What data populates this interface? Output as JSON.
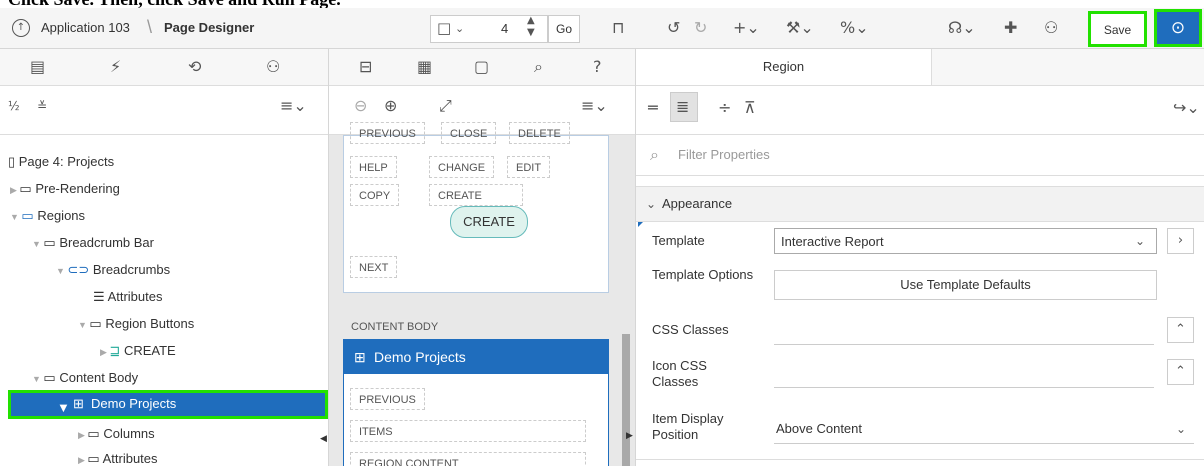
{
  "caption": "Click Save. Then, click Save and Run Page.",
  "header": {
    "app_name": "Application 103",
    "crumb_sep": "\\",
    "page_designer": "Page Designer",
    "page_number": "4",
    "go_label": "Go",
    "save_label": "Save"
  },
  "left": {
    "tree": [
      {
        "label": "Page 4: Projects"
      },
      {
        "label": "Pre-Rendering"
      },
      {
        "label": "Regions"
      },
      {
        "label": "Breadcrumb Bar"
      },
      {
        "label": "Breadcrumbs"
      },
      {
        "label": "Attributes"
      },
      {
        "label": "Region Buttons"
      },
      {
        "label": "CREATE"
      },
      {
        "label": "Content Body"
      },
      {
        "label": "Demo Projects"
      },
      {
        "label": "Columns"
      },
      {
        "label": "Attributes"
      }
    ]
  },
  "middle": {
    "top_buttons": [
      "PREVIOUS",
      "CLOSE",
      "DELETE"
    ],
    "buttons": [
      "HELP",
      "CHANGE",
      "EDIT",
      "COPY",
      "CREATE",
      "NEXT"
    ],
    "create_button": "CREATE",
    "content_body_label": "CONTENT BODY",
    "demo_title": "Demo Projects",
    "demo_buttons": [
      "PREVIOUS",
      "ITEMS",
      "REGION CONTENT"
    ]
  },
  "right": {
    "tab": "Region",
    "filter_placeholder": "Filter Properties",
    "section": "Appearance",
    "template_label": "Template",
    "template_value": "Interactive Report",
    "template_options_label": "Template Options",
    "use_template_defaults": "Use Template Defaults",
    "css_classes_label": "CSS Classes",
    "icon_css_label": "Icon CSS Classes",
    "item_display_label": "Item Display Position",
    "item_display_value": "Above Content"
  }
}
